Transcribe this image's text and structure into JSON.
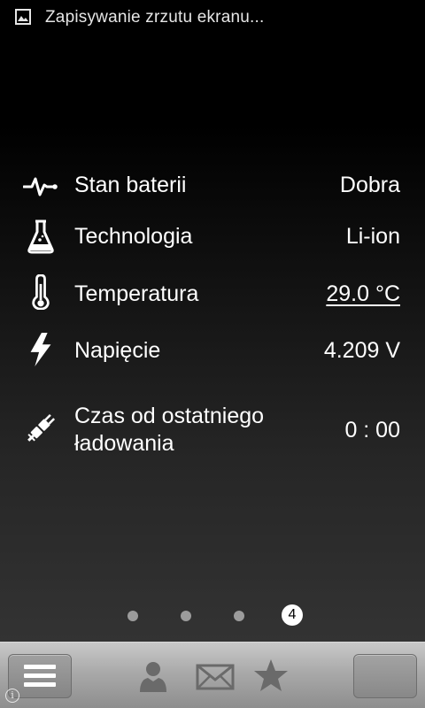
{
  "status_bar": {
    "notification_icon": "image-icon",
    "text": "Zapisywanie zrzutu ekranu..."
  },
  "battery_info": {
    "rows": [
      {
        "icon": "heartbeat-icon",
        "label": "Stan baterii",
        "value": "Dobra"
      },
      {
        "icon": "flask-icon",
        "label": "Technologia",
        "value": "Li-ion"
      },
      {
        "icon": "thermometer-icon",
        "label": "Temperatura",
        "value": "29.0 °C"
      },
      {
        "icon": "lightning-icon",
        "label": "Napięcie",
        "value": "4.209 V"
      },
      {
        "icon": "plug-icon",
        "label_line1": "Czas od ostatniego",
        "label_line2": "ładowania",
        "value": "0 : 00"
      }
    ]
  },
  "page_indicator": {
    "total": 4,
    "current": "4"
  },
  "toolbar": {
    "left_button_icon": "menu-icon",
    "center_icons": [
      "contacts-icon",
      "mail-icon",
      "star-icon"
    ],
    "info_icon_glyph": "i"
  }
}
